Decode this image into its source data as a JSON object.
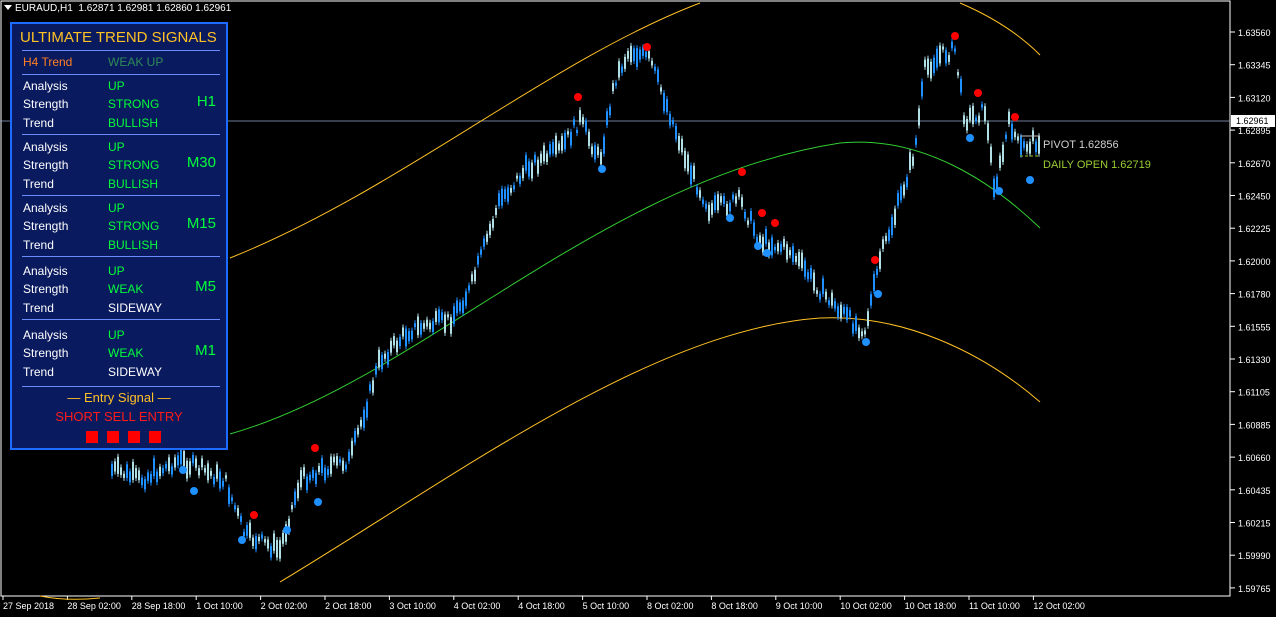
{
  "header": {
    "symbol_tf": "EURAUD,H1",
    "ohlc": "1.62871 1.62981 1.62860 1.62961"
  },
  "colors": {
    "background": "#000000",
    "candle_up": "#b0e0e6",
    "candle_down": "#1e90ff",
    "band": "#ffc125",
    "middle_line": "#32cd32",
    "signal_sell": "#ff0000",
    "signal_buy": "#1e90ff",
    "panel_bg": "#0a1a5e",
    "panel_border": "#1e6cff"
  },
  "price_axis": {
    "labels": [
      "1.63560",
      "1.63345",
      "1.63120",
      "1.62961",
      "1.62895",
      "1.62670",
      "1.62450",
      "1.62225",
      "1.62000",
      "1.61780",
      "1.61555",
      "1.61330",
      "1.61105",
      "1.60885",
      "1.60660",
      "1.60435",
      "1.60215",
      "1.59990",
      "1.59765"
    ],
    "current": "1.62961"
  },
  "time_axis": {
    "labels": [
      "27 Sep 2018",
      "28 Sep 02:00",
      "28 Sep 18:00",
      "1 Oct 10:00",
      "2 Oct 02:00",
      "2 Oct 18:00",
      "3 Oct 10:00",
      "4 Oct 02:00",
      "4 Oct 18:00",
      "5 Oct 10:00",
      "8 Oct 02:00",
      "8 Oct 18:00",
      "9 Oct 10:00",
      "10 Oct 02:00",
      "10 Oct 18:00",
      "11 Oct 10:00",
      "12 Oct 02:00"
    ]
  },
  "pivot": {
    "label": "PIVOT 1.62856"
  },
  "daily_open": {
    "label": "DAILY OPEN 1.62719"
  },
  "panel": {
    "title": "ULTIMATE TREND SIGNALS",
    "h4_label": "H4 Trend",
    "h4_value": "WEAK UP",
    "rows": [
      {
        "tf": "H1",
        "analysis": "UP",
        "strength": "STRONG",
        "trend": "BULLISH"
      },
      {
        "tf": "M30",
        "analysis": "UP",
        "strength": "STRONG",
        "trend": "BULLISH"
      },
      {
        "tf": "M15",
        "analysis": "UP",
        "strength": "STRONG",
        "trend": "BULLISH"
      },
      {
        "tf": "M5",
        "analysis": "UP",
        "strength": "WEAK",
        "trend": "SIDEWAY"
      },
      {
        "tf": "M1",
        "analysis": "UP",
        "strength": "WEAK",
        "trend": "SIDEWAY"
      }
    ],
    "analysis_label": "Analysis",
    "strength_label": "Strength",
    "trend_label": "Trend",
    "entry_heading": "— Entry Signal —",
    "entry_signal": "SHORT SELL ENTRY"
  }
}
